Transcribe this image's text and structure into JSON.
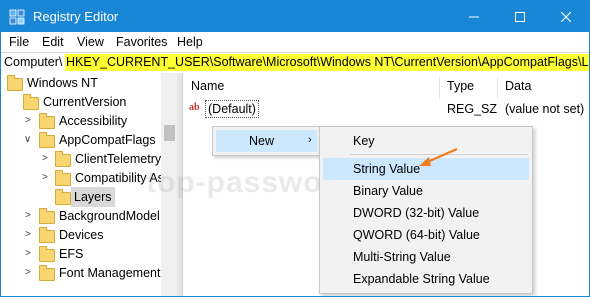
{
  "window": {
    "title": "Registry Editor",
    "title_color": "#1a86d6"
  },
  "menubar": [
    "File",
    "Edit",
    "View",
    "Favorites",
    "Help"
  ],
  "address": {
    "prefix": "Computer\\",
    "highlighted": "HKEY_CURRENT_USER\\Software\\Microsoft\\Windows NT\\CurrentVersion\\AppCompatFlags\\Layers",
    "highlight_color": "#ffff33"
  },
  "tree": {
    "items": [
      {
        "label": "Windows NT"
      },
      {
        "label": "CurrentVersion"
      },
      {
        "label": "Accessibility"
      },
      {
        "label": "AppCompatFlags"
      },
      {
        "label": "ClientTelemetry"
      },
      {
        "label": "Compatibility As"
      },
      {
        "label": "Layers"
      },
      {
        "label": "BackgroundModel"
      },
      {
        "label": "Devices"
      },
      {
        "label": "EFS"
      },
      {
        "label": "Font Management"
      }
    ]
  },
  "list": {
    "columns": [
      "Name",
      "Type",
      "Data"
    ],
    "rows": [
      {
        "name": "(Default)",
        "type": "REG_SZ",
        "data": "(value not set)",
        "icon": "ab-string-icon"
      }
    ]
  },
  "context_menu": {
    "new_label": "New",
    "arrow": "›"
  },
  "submenu": {
    "items": [
      "Key",
      "String Value",
      "Binary Value",
      "DWORD (32-bit) Value",
      "QWORD (64-bit) Value",
      "Multi-String Value",
      "Expandable String Value"
    ],
    "highlight_color": "#cce8ff"
  },
  "watermark": "top-password.com",
  "annotation_color": "#f07c1b"
}
